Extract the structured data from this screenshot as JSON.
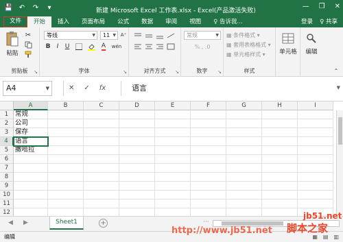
{
  "window": {
    "title": "新建 Microsoft Excel 工作表.xlsx - Excel(产品激活失败)",
    "min_icon": "—",
    "restore_icon": "❐",
    "close_icon": "✕"
  },
  "qat": {
    "save": "💾",
    "undo": "↶",
    "redo": "↷",
    "more": "▾"
  },
  "tabs": [
    "文件",
    "开始",
    "插入",
    "页面布局",
    "公式",
    "数据",
    "审阅",
    "视图"
  ],
  "tell_me": "♀ 告诉我...",
  "account": {
    "login": "登录",
    "share": "♀ 共享"
  },
  "ribbon": {
    "clipboard": {
      "paste": "粘贴",
      "label": "剪贴板"
    },
    "font": {
      "name": "等线",
      "size": "11",
      "grow": "A⁺",
      "shrink": "A⁻",
      "bold": "B",
      "italic": "I",
      "underline": "U",
      "label": "字体",
      "wen": "wén"
    },
    "alignment": {
      "label": "对齐方式"
    },
    "number": {
      "format": "常规",
      "label": "数字"
    },
    "styles": {
      "conditional": "条件格式",
      "table": "套用表格格式",
      "cell_styles": "单元格样式",
      "label": "样式"
    },
    "cells": {
      "label": "单元格"
    },
    "editing": {
      "label": "编辑"
    }
  },
  "formula_bar": {
    "name_box": "A4",
    "cancel": "✕",
    "enter": "✓",
    "fx": "fx",
    "value": "语言"
  },
  "columns": [
    "A",
    "B",
    "C",
    "D",
    "E",
    "F",
    "G",
    "H",
    "I"
  ],
  "rows": [
    "1",
    "2",
    "3",
    "4",
    "5",
    "6",
    "7",
    "8",
    "9",
    "10",
    "11",
    "12"
  ],
  "cells": {
    "A1": "常规",
    "A2": "公司",
    "A3": "保存",
    "A4": "语言",
    "A5": "撒哈拉"
  },
  "sheet": {
    "name": "Sheet1",
    "add": "+",
    "prev": "◀",
    "next": "▶",
    "more": "···"
  },
  "status": {
    "mode": "编辑"
  },
  "watermarks": {
    "site": "jb51.net",
    "brand": "脚本之家",
    "url": "http://www.jb51.net"
  },
  "colors": {
    "accent": "#217346",
    "highlight": "#e03a2a"
  }
}
